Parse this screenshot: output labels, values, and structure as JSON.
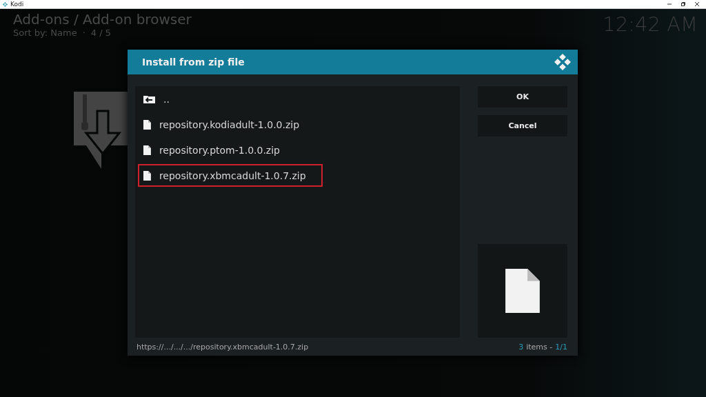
{
  "window": {
    "title": "Kodi"
  },
  "header": {
    "breadcrumb": "Add-ons / Add-on browser",
    "sort": "Sort by: Name",
    "separator": "·",
    "position": "4 / 5",
    "clock": "12:42 AM"
  },
  "dialog": {
    "title": "Install from zip file",
    "items": [
      {
        "kind": "parent",
        "label": "..",
        "highlighted": false
      },
      {
        "kind": "file",
        "label": "repository.kodiadult-1.0.0.zip",
        "highlighted": false
      },
      {
        "kind": "file",
        "label": "repository.ptom-1.0.0.zip",
        "highlighted": false
      },
      {
        "kind": "file",
        "label": "repository.xbmcadult-1.0.7.zip",
        "highlighted": true
      }
    ],
    "buttons": [
      "OK",
      "Cancel"
    ],
    "path": "https://.../.../.../repository.xbmcadult-1.0.7.zip",
    "count": "3",
    "count_label": "items -",
    "page": "1/1"
  }
}
